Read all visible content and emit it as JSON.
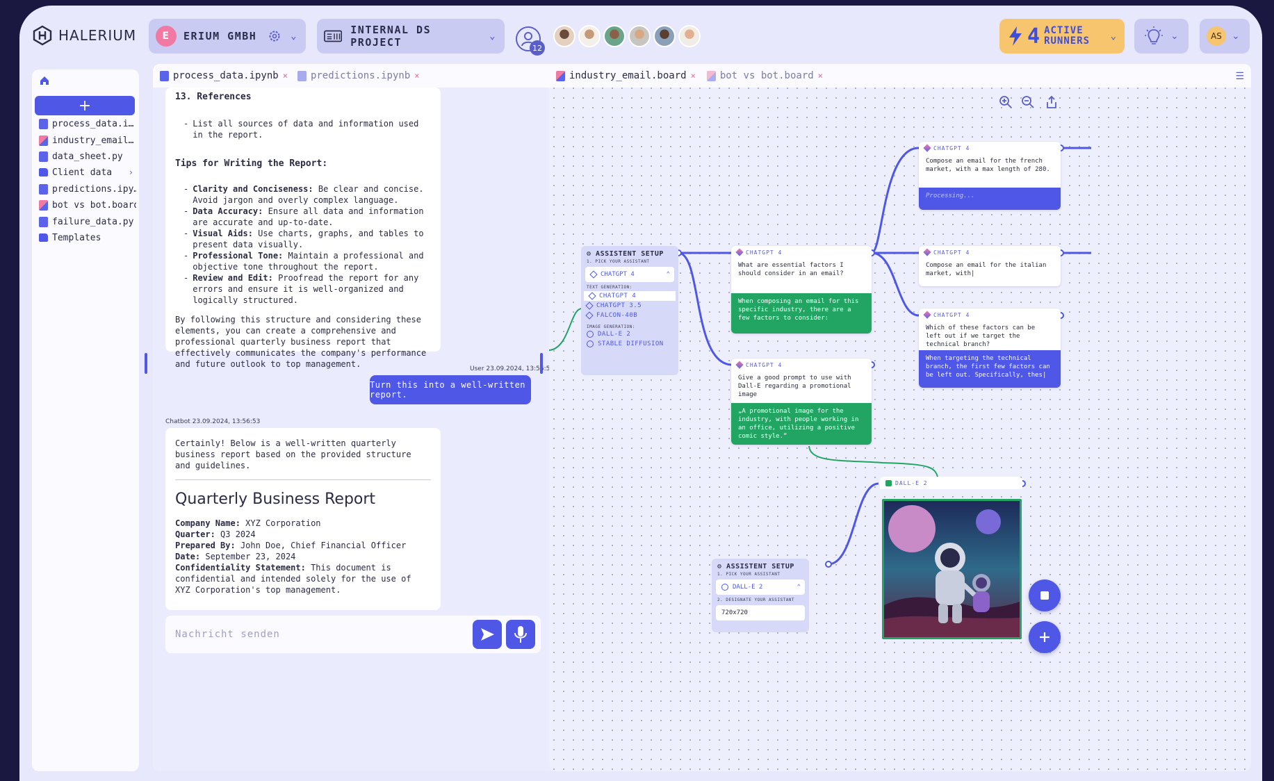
{
  "app": {
    "name": "HALERIUM"
  },
  "org": {
    "badge": "E",
    "name": "ERIUM GMBH"
  },
  "project": {
    "name": "INTERNAL DS PROJECT"
  },
  "collaborators": {
    "count": "12"
  },
  "runners": {
    "count": "4",
    "line1": "ACTIVE",
    "line2": "RUNNERS"
  },
  "user": {
    "initials": "AS"
  },
  "sidebar": {
    "items": [
      {
        "label": "process_data.i…",
        "type": "doc"
      },
      {
        "label": "industry_email…",
        "type": "board"
      },
      {
        "label": "data_sheet.py",
        "type": "doc"
      },
      {
        "label": "Client data",
        "type": "folder"
      },
      {
        "label": "predictions.ipy…",
        "type": "doc"
      },
      {
        "label": "bot vs bot.board",
        "type": "board"
      },
      {
        "label": "failure_data.py",
        "type": "doc"
      },
      {
        "label": "Templates",
        "type": "folder"
      }
    ]
  },
  "notebook": {
    "tabs": [
      {
        "label": "process_data.ipynb",
        "close": "×"
      },
      {
        "label": "predictions.ipynb",
        "close": "×"
      }
    ],
    "ref_heading": "13. References",
    "ref_item": "List all sources of data and information used in the report.",
    "tips_heading": "Tips for Writing the Report:",
    "tips": [
      {
        "b": "Clarity and Conciseness:",
        "t": "Be clear and concise. Avoid jargon and overly complex language."
      },
      {
        "b": "Data Accuracy:",
        "t": "Ensure all data and information are accurate and up-to-date."
      },
      {
        "b": "Visual Aids:",
        "t": "Use charts, graphs, and tables to present data visually."
      },
      {
        "b": "Professional Tone:",
        "t": "Maintain a professional and objective tone throughout the report."
      },
      {
        "b": "Review and Edit:",
        "t": "Proofread the report for any errors and ensure it is well-organized and logically structured."
      }
    ],
    "closing": "By following this structure and considering these elements, you can create a comprehensive and professional quarterly business report that effectively communicates the company's performance and future outlook to top management.",
    "user_meta": "User 23.09.2024, 13:56:52",
    "user_message": "Turn this into a well-written report.",
    "bot_meta": "Chatbot 23.09.2024, 13:56:53",
    "bot_intro": "Certainly! Below is a well-written quarterly business report based on the provided structure and guidelines.",
    "report_title": "Quarterly Business Report",
    "report_fields": [
      {
        "k": "Company Name:",
        "v": "XYZ Corporation"
      },
      {
        "k": "Quarter:",
        "v": "Q3 2024"
      },
      {
        "k": "Prepared By:",
        "v": "John Doe, Chief Financial Officer"
      },
      {
        "k": "Date:",
        "v": "September 23, 2024"
      },
      {
        "k": "Confidentiality Statement:",
        "v": "This document is confidential and intended solely for the use of XYZ Corporation's top management."
      }
    ],
    "input_placeholder": "Nachricht senden"
  },
  "board": {
    "tabs": [
      {
        "label": "industry_email.board",
        "close": "×"
      },
      {
        "label": "bot vs bot.board",
        "close": "×"
      }
    ],
    "setup1": {
      "title": "ASSISTENT SETUP",
      "sub": "1. PICK YOUR ASSISTANT",
      "selected": "CHATGPT 4",
      "text_gen_label": "TEXT GENERATION:",
      "text_opts": [
        "CHATGPT 4",
        "CHATGPT 3.5",
        "FALCON-40B"
      ],
      "image_gen_label": "IMAGE GENERATION:",
      "image_opts": [
        "DALL-E 2",
        "STABLE DIFFUSION"
      ]
    },
    "setup2": {
      "title": "ASSISTENT SETUP",
      "sub1": "1. PICK YOUR ASSISTANT",
      "selected": "DALL-E 2",
      "sub2": "2. DESIGNATE YOUR ASSISTANT",
      "size": "720x720"
    },
    "nodes": [
      {
        "label": "CHATGPT 4",
        "prompt": "What are essential factors I should consider in an email?",
        "response": "When composing an email for this specific industry, there are a few factors to consider:"
      },
      {
        "label": "CHATGPT 4",
        "prompt": "Give a good prompt to use with Dall-E regarding a promotional image",
        "response": "„A promotional image for the industry, with people working in an office, utilizing a positive comic style.“"
      },
      {
        "label": "CHATGPT 4",
        "prompt": "Compose an email for the french market, with a max length of 280.",
        "response": "Processing..."
      },
      {
        "label": "CHATGPT 4",
        "prompt": "Compose an email for the italian market, with|"
      },
      {
        "label": "CHATGPT 4",
        "prompt": "Which of these factors can be left out if we target the technical branch?",
        "response": "When targeting the technical branch, the first few factors can be left out. Specifically, thes|"
      },
      {
        "label": "DALL-E 2"
      }
    ]
  }
}
